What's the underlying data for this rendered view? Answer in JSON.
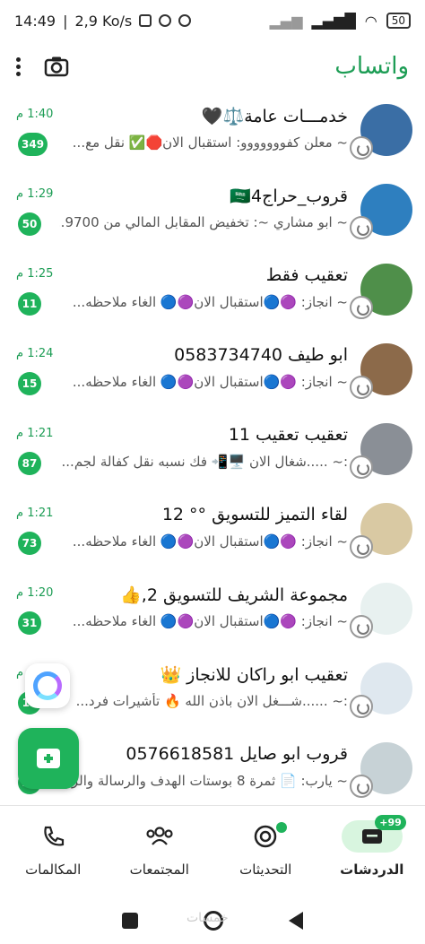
{
  "status_bar": {
    "time": "14:49",
    "speed": "2,9 Ko/s",
    "battery": "50"
  },
  "header": {
    "title": "واتساب"
  },
  "chats": [
    {
      "name": "خدمـــات عامة⚖️🖤",
      "preview": "~ معلن كفووووووو: استقبال الان🛑✅ نقل مع...",
      "time": "1:40 م",
      "unread": "349",
      "avatar_color": "#3a6ea5"
    },
    {
      "name": "قروب_حراج🇸🇦4",
      "preview": "~ ابو مشاري ~: تخفيض المقابل المالي من 9700...",
      "time": "1:29 م",
      "unread": "50",
      "avatar_color": "#2e7fbf"
    },
    {
      "name": "تعقيب فقط",
      "preview": "~ انجاز: 🟣🔵استقبال الان🟣🔵 الغاء ملاحظه...",
      "time": "1:25 م",
      "unread": "11",
      "avatar_color": "#4f8f4a"
    },
    {
      "name": "ابو طيف 0583734740",
      "preview": "~ انجاز: 🟣🔵استقبال الان🟣🔵 الغاء ملاحظه...",
      "time": "1:24 م",
      "unread": "15",
      "avatar_color": "#8c6a4a"
    },
    {
      "name": "تعقيب تعقيب 11",
      "preview": ":~ .....شغال الان 🖥️📲 فك نسبه نقل كفالة لجم...",
      "time": "1:21 م",
      "unread": "87",
      "avatar_color": "#8a8f96"
    },
    {
      "name": "لقاء التميز للتسويق °° 12",
      "preview": "~ انجاز: 🟣🔵استقبال الان🟣🔵 الغاء ملاحظه...",
      "time": "1:21 م",
      "unread": "73",
      "avatar_color": "#d9c9a3"
    },
    {
      "name": "مجموعة الشريف للتسويق 2,👍",
      "preview": "~ انجاز: 🟣🔵استقبال الان🟣🔵 الغاء ملاحظه...",
      "time": "1:20 م",
      "unread": "31",
      "avatar_color": "#e8f1f0"
    },
    {
      "name": "تعقيب ابو راكان للانجاز 👑",
      "preview": ":~ ......شـــغل الان باذن الله 🔥 تأشيرات فرد...",
      "time": "م",
      "unread": "13",
      "avatar_color": "#dfe8ef"
    },
    {
      "name": "قروب ابو صايل 0576618581",
      "preview": "~ يارب: 📄 ثمرة 8 بوستات الهدف والرسالة والرؤ...",
      "time": "",
      "unread": "24",
      "avatar_color": "#c7d2d6"
    }
  ],
  "nav": {
    "chats": "الدردشات",
    "updates": "التحديثات",
    "communities": "المجتمعات",
    "calls": "المكالمات",
    "chats_count": "99+"
  },
  "watermark": "خمسات"
}
